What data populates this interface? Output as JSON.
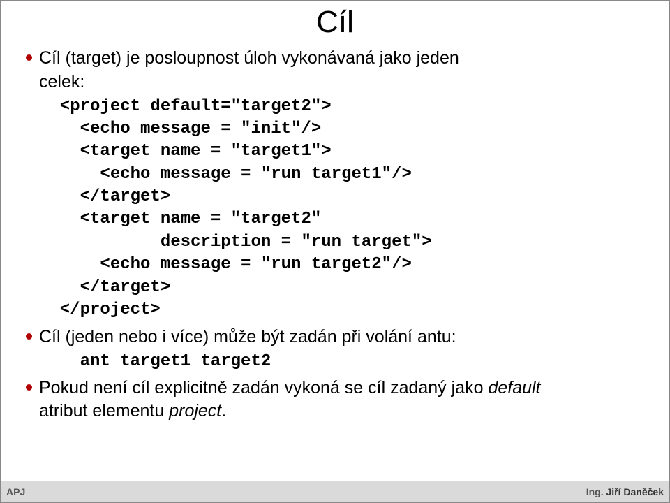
{
  "title": "Cíl",
  "bullets": {
    "b1_part1": "Cíl (target) je posloupnost úloh vykonávaná jako jeden",
    "b1_part2": "celek:",
    "b2_part1": "Cíl (jeden nebo i více) může být zadán při volání antu:",
    "b3_part1": "Pokud není cíl explicitně zadán vykoná se cíl zadaný jako ",
    "b3_italic": "default",
    "b3_part2": "atribut elementu ",
    "b3_italic2": "project",
    "b3_part3": "."
  },
  "code": {
    "l1": "  <project default=\"target2\">",
    "l2": "    <echo message = \"init\"/>",
    "l3": "    <target name = \"target1\">",
    "l4": "      <echo message = \"run target1\"/>",
    "l5": "    </target>",
    "l6": "    <target name = \"target2\"",
    "l7": "            description = \"run target\">",
    "l8": "      <echo message = \"run target2\"/>",
    "l9": "    </target>",
    "l10": "  </project>",
    "ant": "    ant target1 target2"
  },
  "footer": {
    "left": "APJ",
    "right_prefix": "Ing. ",
    "right_bold": "Jiří Daněček"
  }
}
